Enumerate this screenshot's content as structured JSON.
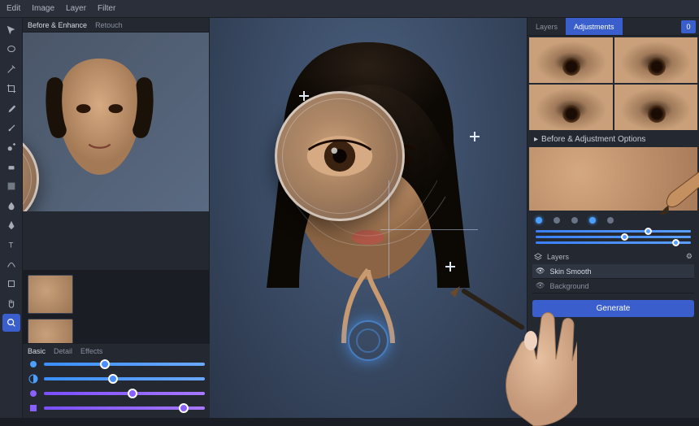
{
  "menubar": {
    "items": [
      "Edit",
      "Image",
      "Layer",
      "Filter"
    ]
  },
  "toolbox": {
    "tools": [
      "move",
      "lasso",
      "magic-wand",
      "crop",
      "eyedropper",
      "brush",
      "clone",
      "eraser",
      "gradient",
      "blur",
      "pen",
      "text",
      "path",
      "shape",
      "hand",
      "zoom"
    ],
    "active": "zoom"
  },
  "ref_panel": {
    "tabs": [
      "Before & Enhance",
      "Retouch"
    ],
    "active_tab": 0
  },
  "thumbs": {
    "count": 3
  },
  "sliders_panel": {
    "tabs": [
      "Basic",
      "Detail",
      "Effects"
    ],
    "active_tab": 0,
    "sliders": [
      {
        "icon": "exposure",
        "value": 35,
        "style": "blue"
      },
      {
        "icon": "contrast",
        "value": 40,
        "style": "blue"
      },
      {
        "icon": "vibrance",
        "value": 52,
        "style": "purple"
      },
      {
        "icon": "saturation",
        "value": 84,
        "style": "purple"
      }
    ]
  },
  "right_panel": {
    "tabs": [
      "Layers",
      "Adjustments"
    ],
    "active_tab": 1,
    "badge": "0",
    "section_title": "Before & Adjustment Options",
    "dots": [
      true,
      false,
      false,
      true,
      false
    ],
    "sliders": [
      {
        "value": 70
      },
      {
        "value": 55
      },
      {
        "value": 88
      }
    ],
    "layer_header": "Layers",
    "layers": [
      {
        "name": "Skin Smooth",
        "visible": true,
        "active": true
      },
      {
        "name": "Background",
        "visible": true,
        "active": false
      }
    ],
    "button": "Generate"
  }
}
